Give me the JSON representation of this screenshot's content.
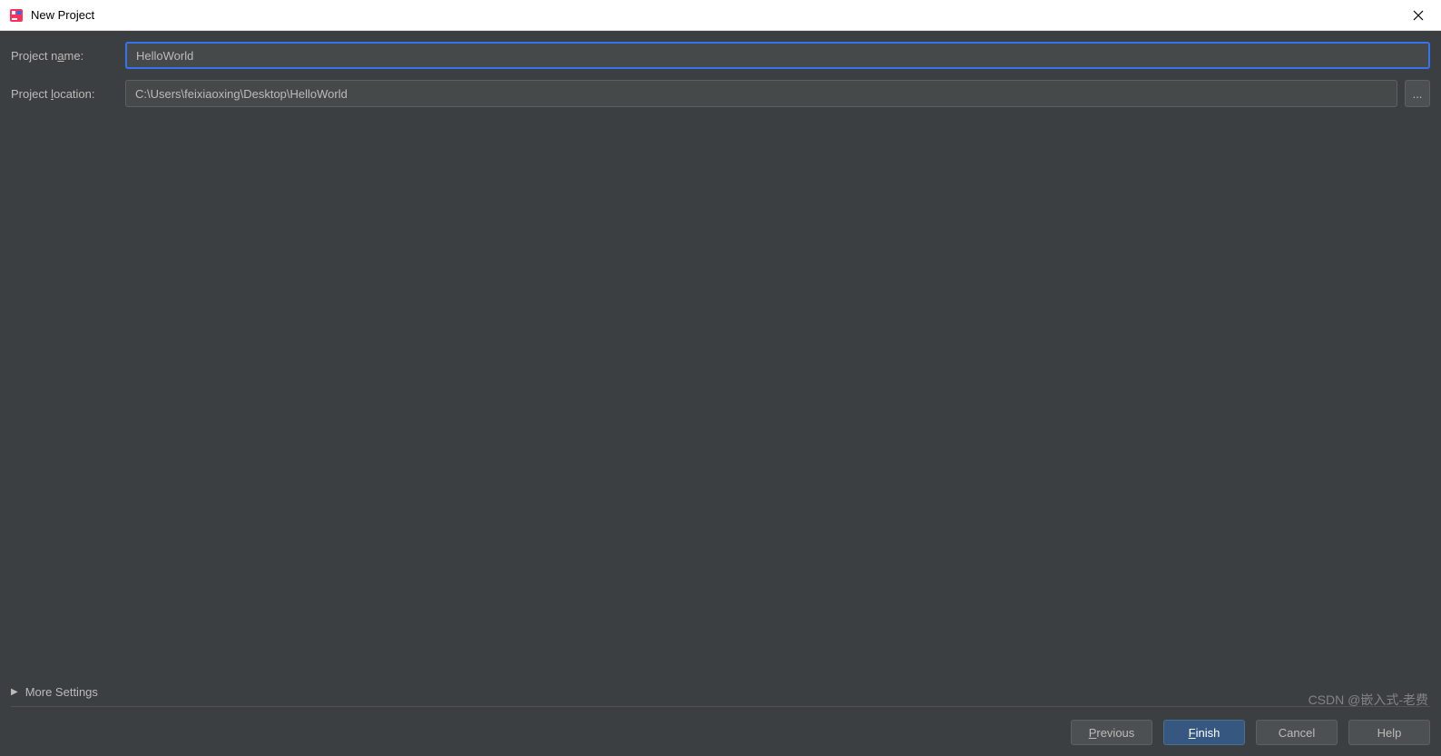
{
  "window": {
    "title": "New Project"
  },
  "form": {
    "projectName": {
      "label_pre": "Project n",
      "label_mnemonic": "a",
      "label_post": "me:",
      "value": "HelloWorld"
    },
    "projectLocation": {
      "label_pre": "Project ",
      "label_mnemonic": "l",
      "label_post": "ocation:",
      "value": "C:\\Users\\feixiaoxing\\Desktop\\HelloWorld"
    },
    "browseButton": "...",
    "moreSettings": "More Settings"
  },
  "buttons": {
    "previous": {
      "mnemonic": "P",
      "rest": "revious"
    },
    "finish": {
      "mnemonic": "F",
      "rest": "inish"
    },
    "cancel": "Cancel",
    "help": "Help"
  },
  "watermark": "CSDN @嵌入式-老费"
}
